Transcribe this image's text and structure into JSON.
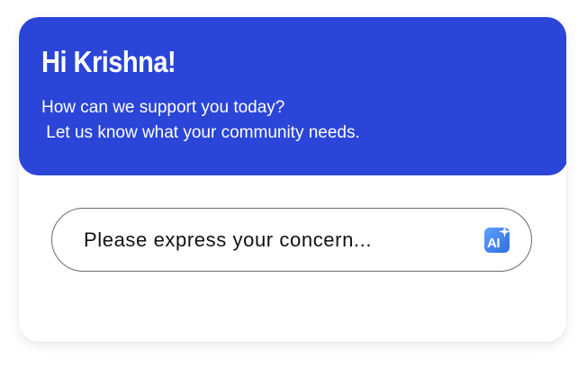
{
  "header": {
    "greeting": "Hi Krishna!",
    "subtitle": "How can we support you today?\n Let us know what your community needs."
  },
  "concern": {
    "placeholder": "Please express your concern...",
    "value": ""
  },
  "ai_assist": {
    "label": "AI",
    "icon": "ai-sparkle-icon"
  },
  "colors": {
    "header_background": "#2a45d8",
    "header_text": "#ffffff",
    "input_border": "#6b6b6b",
    "ai_icon_gradient_start": "#5fa0ff",
    "ai_icon_gradient_end": "#2f6fe0"
  }
}
